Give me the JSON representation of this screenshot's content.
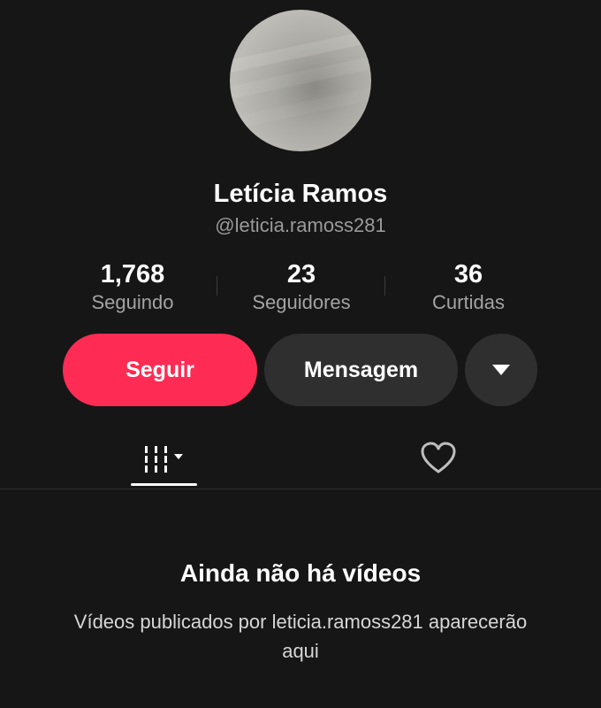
{
  "profile": {
    "name": "Letícia Ramos",
    "handle": "@leticia.ramoss281"
  },
  "stats": [
    {
      "value": "1,768",
      "label": "Seguindo"
    },
    {
      "value": "23",
      "label": "Seguidores"
    },
    {
      "value": "36",
      "label": "Curtidas"
    }
  ],
  "actions": {
    "follow_label": "Seguir",
    "message_label": "Mensagem",
    "more_icon": "caret-down-icon"
  },
  "tabs": [
    {
      "icon": "video-grid-icon",
      "active": true
    },
    {
      "icon": "heart-icon",
      "active": false
    }
  ],
  "empty_state": {
    "title": "Ainda não há vídeos",
    "description": "Vídeos publicados por leticia.ramoss281 aparecerão aqui"
  },
  "colors": {
    "background": "#161616",
    "accent": "#fe2c55",
    "button_secondary": "#2f2f2f",
    "muted_text": "#a3a3a3"
  }
}
